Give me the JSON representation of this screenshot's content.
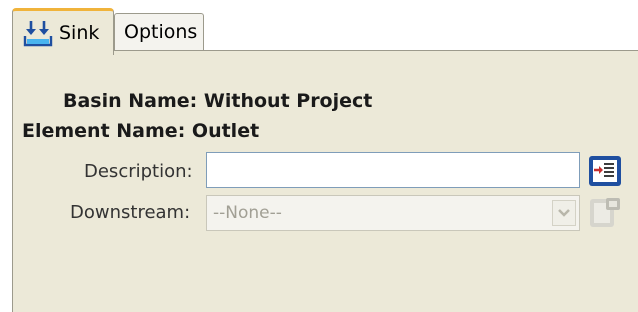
{
  "tabs": [
    {
      "label": "Sink",
      "icon": "sink-icon",
      "selected": true
    },
    {
      "label": "Options",
      "selected": false
    }
  ],
  "header": {
    "basin_name_label": "Basin Name:",
    "basin_name_value": "Without Project",
    "element_name_label": "Element Name:",
    "element_name_value": "Outlet"
  },
  "form": {
    "description_label": "Description:",
    "description_value": "",
    "downstream_label": "Downstream:",
    "downstream_value": "--None--",
    "downstream_disabled": true
  },
  "colors": {
    "panel_bg": "#ece9d8",
    "tab_accent": "#f0b33b",
    "input_border": "#7f9db9",
    "icon_blue": "#1f4fa0"
  }
}
